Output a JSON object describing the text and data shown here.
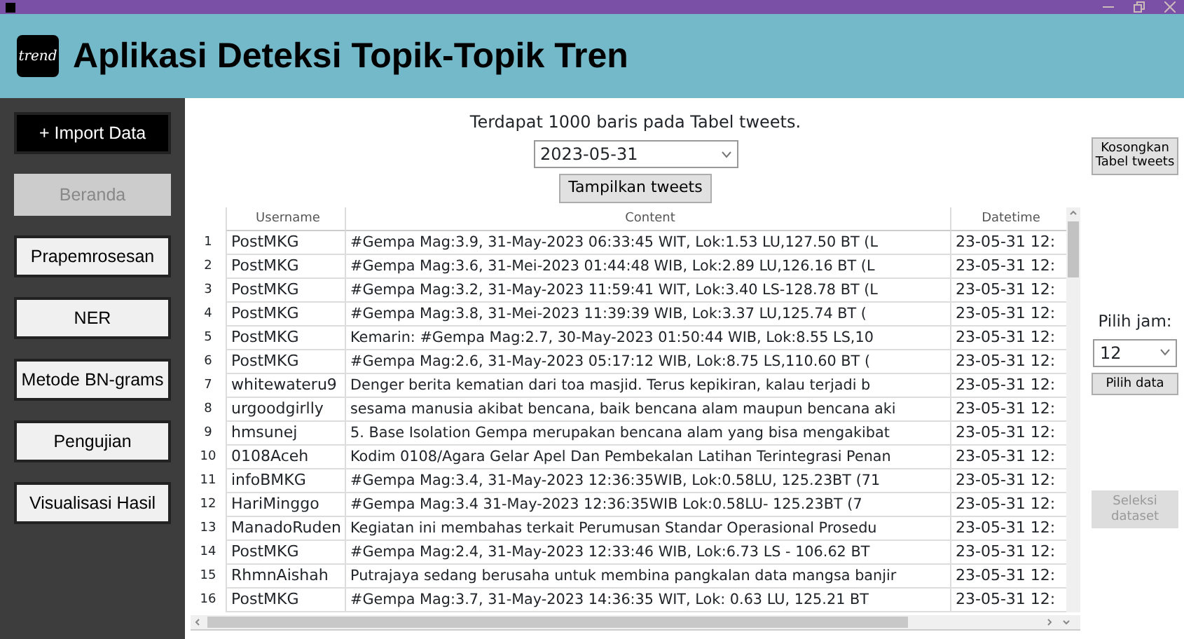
{
  "header": {
    "logo_text": "trend",
    "title": "Aplikasi Deteksi Topik-Topik Tren"
  },
  "sidebar": {
    "buttons": [
      {
        "label": "+ Import Data",
        "kind": "primary",
        "disabled": false
      },
      {
        "label": "Beranda",
        "kind": "nav",
        "disabled": true
      },
      {
        "label": "Prapemrosesan",
        "kind": "nav",
        "disabled": false
      },
      {
        "label": "NER",
        "kind": "nav",
        "disabled": false
      },
      {
        "label": "Metode BN-grams",
        "kind": "nav",
        "disabled": false
      },
      {
        "label": "Pengujian",
        "kind": "nav",
        "disabled": false
      },
      {
        "label": "Visualisasi Hasil",
        "kind": "nav",
        "disabled": false
      }
    ]
  },
  "main": {
    "info_text": "Terdapat 1000 baris pada Tabel tweets.",
    "date_select": "2023-05-31",
    "show_button": "Tampilkan tweets"
  },
  "table": {
    "columns": [
      "Username",
      "Content",
      "Datetime"
    ],
    "rows": [
      {
        "no": "1",
        "username": "PostMKG",
        "content": "#Gempa Mag:3.9, 31-May-2023 06:33:45 WIT, Lok:1.53 LU,127.50 BT (L",
        "datetime": "23-05-31 12:"
      },
      {
        "no": "2",
        "username": "PostMKG",
        "content": "#Gempa Mag:3.6, 31-Mei-2023 01:44:48 WIB, Lok:2.89 LU,126.16 BT (L",
        "datetime": "23-05-31 12:"
      },
      {
        "no": "3",
        "username": "PostMKG",
        "content": "#Gempa Mag:3.2, 31-May-2023 11:59:41 WIT, Lok:3.40 LS-128.78 BT (L",
        "datetime": "23-05-31 12:"
      },
      {
        "no": "4",
        "username": "PostMKG",
        "content": "#Gempa Mag:3.8, 31-Mei-2023 11:39:39 WIB, Lok:3.37 LU,125.74 BT (",
        "datetime": "23-05-31 12:"
      },
      {
        "no": "5",
        "username": "PostMKG",
        "content": "Kemarin: #Gempa Mag:2.7, 30-May-2023 01:50:44 WIB, Lok:8.55 LS,10",
        "datetime": "23-05-31 12:"
      },
      {
        "no": "6",
        "username": "PostMKG",
        "content": "#Gempa Mag:2.6, 31-May-2023 05:17:12 WIB, Lok:8.75 LS,110.60 BT (",
        "datetime": "23-05-31 12:"
      },
      {
        "no": "7",
        "username": "whitewateru9",
        "content": "Denger berita kematian dari toa masjid. Terus kepikiran, kalau terjadi b",
        "datetime": "23-05-31 12:"
      },
      {
        "no": "8",
        "username": "urgoodgirlly",
        "content": "sesama manusia akibat bencana, baik bencana alam maupun bencana aki",
        "datetime": "23-05-31 12:"
      },
      {
        "no": "9",
        "username": "hmsunej",
        "content": "5. Base Isolation Gempa merupakan bencana alam yang bisa mengakibat",
        "datetime": "23-05-31 12:"
      },
      {
        "no": "10",
        "username": "0108Aceh",
        "content": "Kodim 0108/Agara Gelar Apel Dan Pembekalan Latihan Terintegrasi Penan",
        "datetime": "23-05-31 12:"
      },
      {
        "no": "11",
        "username": "infoBMKG",
        "content": "#Gempa Mag:3.4, 31-May-2023 12:36:35WIB, Lok:0.58LU, 125.23BT (71",
        "datetime": "23-05-31 12:"
      },
      {
        "no": "12",
        "username": "HariMinggo",
        "content": "#Gempa Mag:3.4 31-May-2023 12:36:35WIB Lok:0.58LU- 125.23BT (7",
        "datetime": "23-05-31 12:"
      },
      {
        "no": "13",
        "username": "ManadoRuden",
        "content": "Kegiatan ini membahas terkait Perumusan Standar Operasional Prosedu",
        "datetime": "23-05-31 12:"
      },
      {
        "no": "14",
        "username": "PostMKG",
        "content": "#Gempa Mag:2.4, 31-May-2023 12:33:46 WIB, Lok:6.73 LS - 106.62 BT",
        "datetime": "23-05-31 12:"
      },
      {
        "no": "15",
        "username": "RhmnAishah",
        "content": "Putrajaya sedang berusaha untuk membina pangkalan data mangsa banjir",
        "datetime": "23-05-31 12:"
      },
      {
        "no": "16",
        "username": "PostMKG",
        "content": "#Gempa Mag:3.7, 31-May-2023 14:36:35 WIT, Lok: 0.63 LU, 125.21 BT",
        "datetime": "23-05-31 12:"
      }
    ]
  },
  "right_panel": {
    "clear_button": "Kosongkan Tabel tweets",
    "hour_label": "Pilih jam:",
    "hour_select": "12",
    "pick_button": "Pilih data",
    "select_dataset_button": {
      "label": "Seleksi dataset",
      "disabled": true
    }
  }
}
